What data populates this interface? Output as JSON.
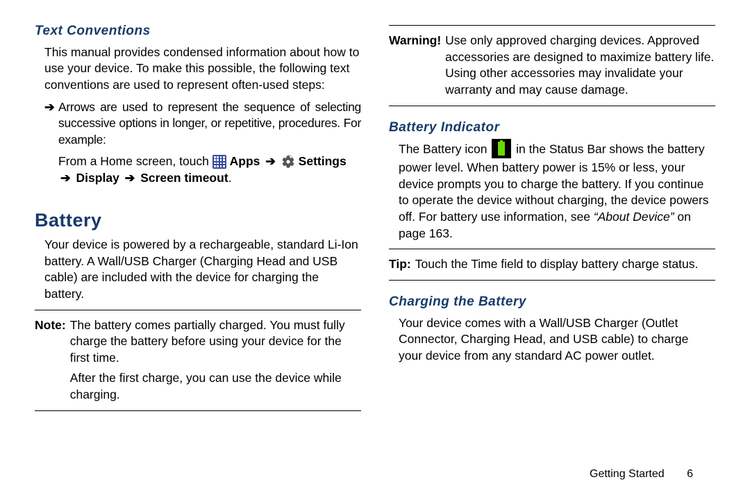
{
  "left": {
    "textconv_head": "Text Conventions",
    "textconv_body": "This manual provides condensed information about how to use your device. To make this possible, the following text conventions are used to represent often-used steps:",
    "bullet_arrow": "➔",
    "bullet_text": "Arrows are used to represent the sequence of selecting successive options in longer, or repetitive, procedures. For example:",
    "example_prefix": "From a Home screen, touch ",
    "apps_label": "Apps",
    "arrow": "➔",
    "settings_label": "Settings",
    "display_label": "Display",
    "screen_label": "Screen timeout",
    "period": ".",
    "battery_head": "Battery",
    "battery_body": "Your device is powered by a rechargeable, standard Li-Ion battery. A Wall/USB Charger (Charging Head and USB cable) are included with the device for charging the battery.",
    "note_label": "Note:",
    "note_1": "The battery comes partially charged. You must fully charge the battery before using your device for the first time.",
    "note_2": "After the first charge, you can use the device while charging."
  },
  "right": {
    "warn_label": "Warning!",
    "warn_body": "Use only approved charging devices. Approved accessories are designed to maximize battery life. Using other accessories may invalidate your warranty and may cause damage.",
    "batind_head": "Battery Indicator",
    "batind_1a": "The Battery icon ",
    "batind_1b": " in the Status Bar shows the battery power level. When battery power is 15% or less, your device prompts you to charge the battery. If you continue to operate the device without charging, the device powers off. For battery use information, see ",
    "batind_ref": "“About Device”",
    "batind_1c": " on page 163.",
    "tip_label": "Tip:",
    "tip_body": "Touch the Time field to display battery charge status.",
    "charge_head": "Charging the Battery",
    "charge_body": "Your device comes with a Wall/USB Charger (Outlet Connector, Charging Head, and USB cable) to charge your device from any standard AC power outlet."
  },
  "footer": {
    "section": "Getting Started",
    "page": "6"
  }
}
